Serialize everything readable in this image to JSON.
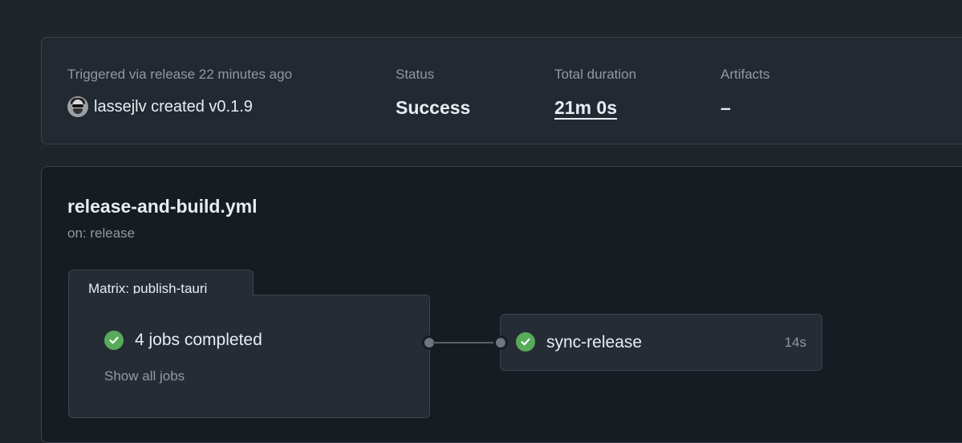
{
  "summary": {
    "trigger_label": "Triggered via release 22 minutes ago",
    "trigger_text": "lassejlv created v0.1.9",
    "status_label": "Status",
    "status_value": "Success",
    "duration_label": "Total duration",
    "duration_value": "21m 0s",
    "artifacts_label": "Artifacts",
    "artifacts_value": "–"
  },
  "workflow": {
    "title": "release-and-build.yml",
    "trigger": "on: release",
    "matrix": {
      "label": "Matrix: publish-tauri",
      "jobs_summary": "4 jobs completed",
      "show_all": "Show all jobs"
    },
    "job": {
      "name": "sync-release",
      "duration": "14s"
    }
  },
  "colors": {
    "success": "#57ab5a",
    "background": "#20252c"
  }
}
